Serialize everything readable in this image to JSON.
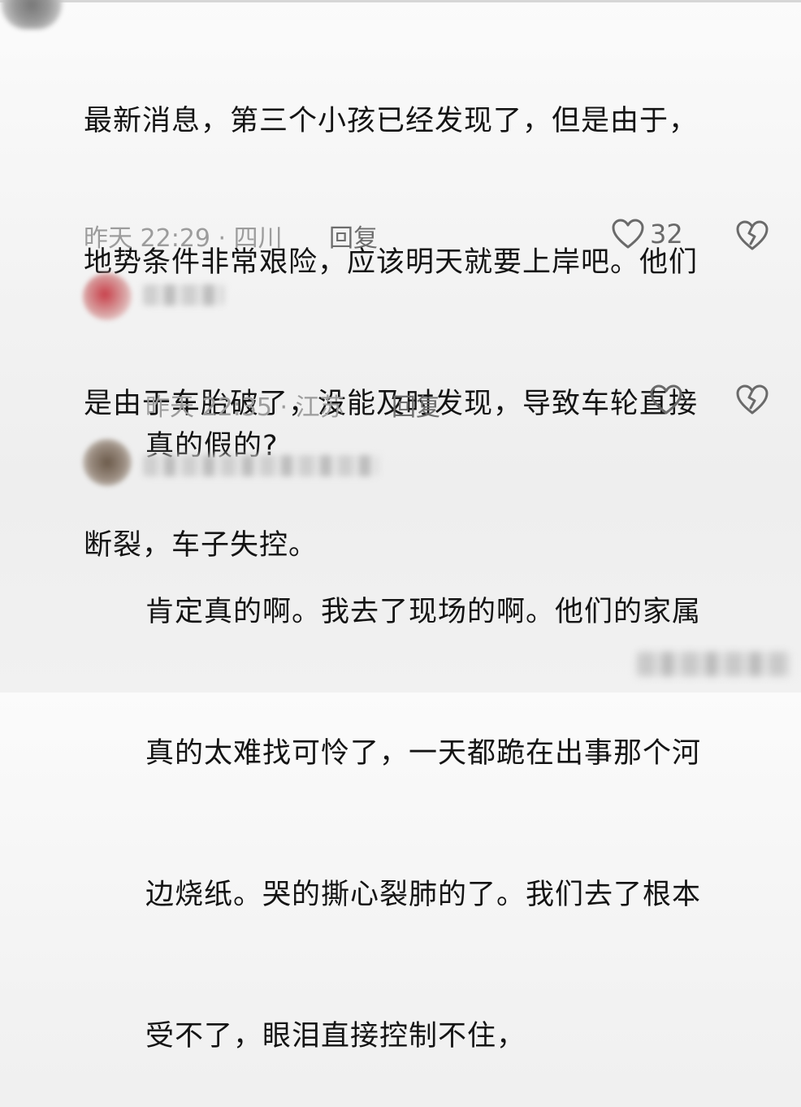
{
  "comments": [
    {
      "text_lines": [
        "最新消息，第三个小孩已经发现了，但是由于，",
        "地势条件非常艰险，应该明天就要上岸吧。他们",
        "是由于车胎破了，没能及时发现，导致车轮直接",
        "断裂，车子失控。"
      ],
      "meta": "昨天 22:29 · 四川",
      "reply_label": "回复",
      "like_count": "32"
    },
    {
      "text_lines": [
        "真的假的?"
      ],
      "meta": "昨天 22:35 · 江苏",
      "reply_label": "回复",
      "like_count": ""
    },
    {
      "text_lines": [
        "肯定真的啊。我去了现场的啊。他们的家属",
        "真的太难找可怜了，一天都跪在出事那个河",
        "边烧纸。哭的撕心裂肺的了。我们去了根本",
        "受不了，眼泪直接控制不住，"
      ],
      "meta": "",
      "reply_label": "",
      "like_count": ""
    }
  ],
  "icons": {
    "like": "heart-outline-icon",
    "dislike": "broken-heart-icon"
  },
  "colors": {
    "text": "#141414",
    "meta": "#9c9c9c",
    "icon": "#6a6a6a"
  }
}
